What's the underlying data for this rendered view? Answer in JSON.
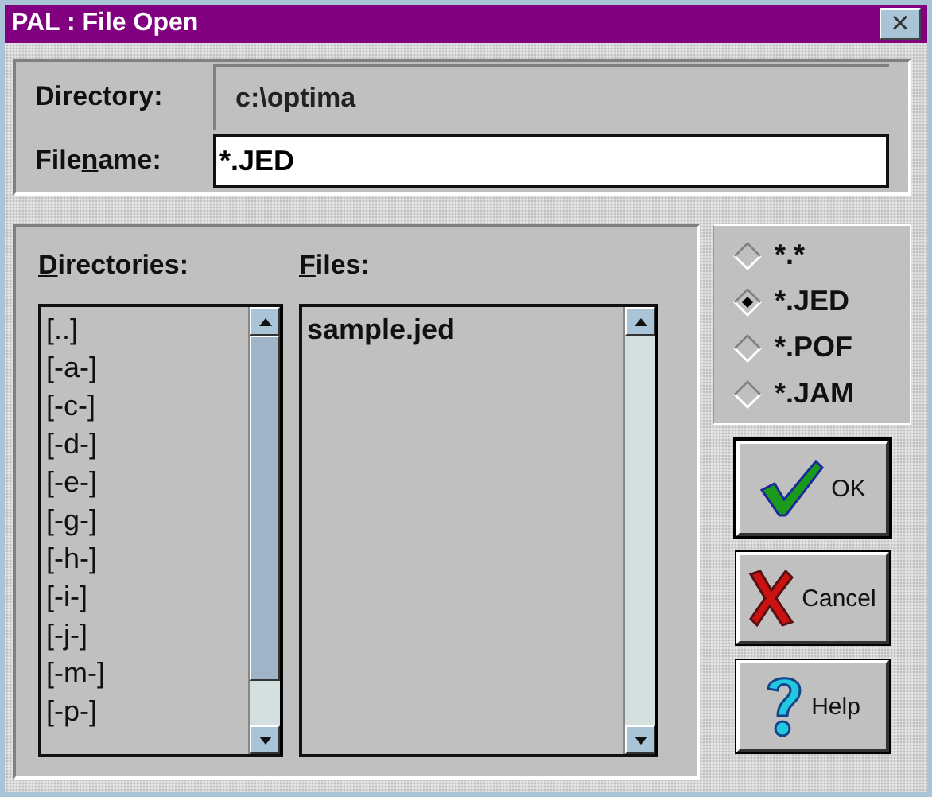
{
  "window": {
    "title": "PAL : File Open",
    "close": "×"
  },
  "directory": {
    "label": "Directory:",
    "value": "c:\\optima"
  },
  "filename": {
    "label": {
      "before": "File",
      "key": "n",
      "after": "ame:"
    },
    "value": "*.JED"
  },
  "directories": {
    "label": {
      "key": "D",
      "after": "irectories:"
    },
    "items": [
      "[..]",
      "[-a-]",
      "[-c-]",
      "[-d-]",
      "[-e-]",
      "[-g-]",
      "[-h-]",
      "[-i-]",
      "[-j-]",
      "[-m-]",
      "[-p-]"
    ]
  },
  "files": {
    "label": {
      "key": "F",
      "after": "iles:"
    },
    "items": [
      "sample.jed"
    ]
  },
  "filters": [
    {
      "label": "*.*",
      "selected": false
    },
    {
      "label": "*.JED",
      "selected": true
    },
    {
      "label": "*.POF",
      "selected": false
    },
    {
      "label": "*.JAM",
      "selected": false
    }
  ],
  "buttons": [
    {
      "kind": "ok",
      "label": "OK",
      "default": true
    },
    {
      "kind": "cancel",
      "label": "Cancel",
      "default": false
    },
    {
      "kind": "help",
      "label": "Help",
      "default": false
    }
  ]
}
